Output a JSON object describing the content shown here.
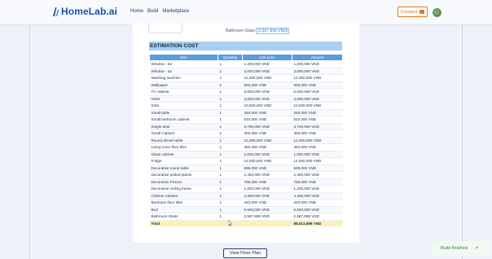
{
  "header": {
    "brand": "HomeLab.ai",
    "nav": [
      "Home",
      "Build",
      "Marketplace"
    ],
    "connect_label": "Connect"
  },
  "previous_line": {
    "label": "Bathroom Glass",
    "value": "[2,567,899 VND]"
  },
  "estimation": {
    "title": "ESTIMATION COST",
    "columns": [
      "Item",
      "Quantity",
      "Unit price",
      "Amount"
    ],
    "rows": [
      [
        "Window - b2",
        "1",
        "1,200,000 VND",
        "1,200,000 VND"
      ],
      [
        "Window - a2",
        "1",
        "3,000,000 VND",
        "3,000,000 VND"
      ],
      [
        "Washing machine",
        "1",
        "12,000,000 VND",
        "12,000,000 VND"
      ],
      [
        "Wallpaper",
        "1",
        "500,000 VND",
        "500,000 VND"
      ],
      [
        "TV cabinet",
        "1",
        "6,000,000 VND",
        "6,000,000 VND"
      ],
      [
        "Toilet",
        "1",
        "3,000,000 VND",
        "3,000,000 VND"
      ],
      [
        "Sofa",
        "1",
        "10,500,000 VND",
        "10,500,000 VND"
      ],
      [
        "Small table",
        "1",
        "250,000 VND",
        "250,000 VND"
      ],
      [
        "Small bedroom cabinet",
        "1",
        "510,000 VND",
        "510,000 VND"
      ],
      [
        "Single door",
        "1",
        "3,700,000 VND",
        "3,700,000 VND"
      ],
      [
        "Small Cabinet",
        "1",
        "300,000 VND",
        "300,000 VND"
      ],
      [
        "Round dinner table",
        "1",
        "12,000,000 VND",
        "12,000,000 VND"
      ],
      [
        "Living room floor tiles",
        "1",
        "450,000 VND",
        "450,000 VND"
      ],
      [
        "Glass cabinet",
        "1",
        "1,000,000 VND",
        "1,000,000 VND"
      ],
      [
        "Fridge",
        "1",
        "14,000,000 VND",
        "14,000,000 VND"
      ],
      [
        "Decorative round table",
        "1",
        "698,000 VND",
        "698,000 VND"
      ],
      [
        "Decorative potted plants",
        "1",
        "2,400,000 VND",
        "2,400,000 VND"
      ],
      [
        "Decorative Picture",
        "1",
        "799,000 VND",
        "799,000 VND"
      ],
      [
        "Decorative ceiling frame",
        "1",
        "1,200,000 VND",
        "1,200,000 VND"
      ],
      [
        "Clothes Cabinet",
        "1",
        "4,499,000 VND",
        "4,499,000 VND"
      ],
      [
        "Bedroom floor tiles",
        "1",
        "340,000 VND",
        "340,000 VND"
      ],
      [
        "Bed",
        "1",
        "5,500,000 VND",
        "5,500,000 VND"
      ],
      [
        "Bathroom Glass",
        "1",
        "2,567,899 VND",
        "2,567,899 VND"
      ]
    ],
    "total_label": "Total",
    "total_amount": "88,513,899 VND"
  },
  "view_floor_plan_label": "View Floor Plan",
  "toast": {
    "message": "Build finished",
    "close": "×"
  },
  "colors": {
    "brand": "#1b4fae",
    "accent": "#e0781e",
    "table_header": "#5b9be0",
    "section_header": "#a9d0f2",
    "total_row": "#fdf0b8"
  }
}
